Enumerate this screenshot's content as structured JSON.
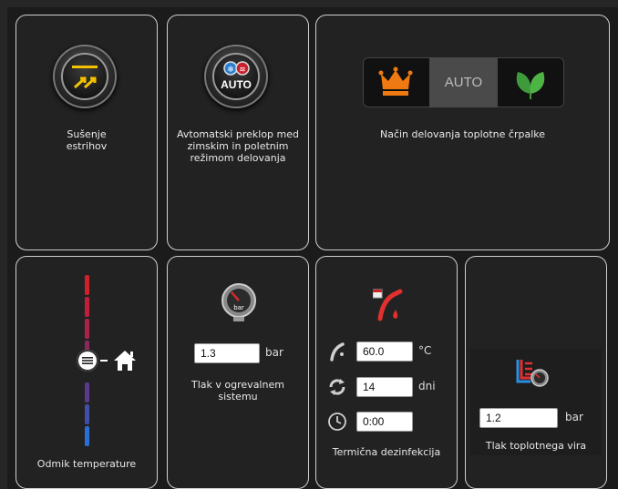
{
  "tiles": {
    "drying": {
      "label_line1": "Sušenje",
      "label_line2": "estrihov",
      "icon": "screed-drying-icon"
    },
    "auto_switch": {
      "knob_text": "AUTO",
      "label_line1": "Avtomatski preklop med",
      "label_line2": "zimskim in poletnim",
      "label_line3": "režimom delovanja",
      "icon": "auto-season-switch-icon"
    },
    "pump_mode": {
      "options": [
        "crown",
        "AUTO",
        "leaf"
      ],
      "selected": "AUTO",
      "auto_label": "AUTO",
      "label": "Način delovanja toplotne črpalke"
    },
    "temp_offset": {
      "label": "Odmik temperature",
      "icon": "home-icon"
    },
    "pressure": {
      "value": "1.3",
      "unit": "bar",
      "label_line1": "Tlak v ogrevalnem",
      "label_line2": "sistemu",
      "icon": "pressure-gauge-icon"
    },
    "disinfection": {
      "temp_value": "60.0",
      "temp_unit": "°C",
      "interval_value": "14",
      "interval_unit": "dni",
      "time_value": "0:00",
      "label": "Termična dezinfekcija",
      "icon": "thermal-disinfection-icon"
    },
    "source_pressure": {
      "value": "1.2",
      "unit": "bar",
      "label": "Tlak toplotnega vira",
      "icon": "heat-source-pressure-icon"
    }
  },
  "colors": {
    "tile_border": "#cfcfcf",
    "scale_red": "#d0202a",
    "scale_blue": "#2a6fd6",
    "auto_active_bg": "#4a4a4a",
    "crown_orange": "#f07a12",
    "leaf_green": "#3e9a3a"
  }
}
